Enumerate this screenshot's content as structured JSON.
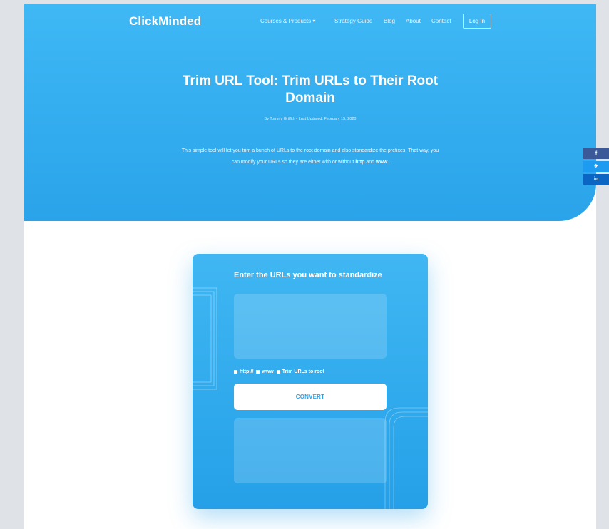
{
  "header": {
    "logo": "ClickMinded",
    "nav": [
      {
        "label": "Courses & Products ▾"
      },
      {
        "label": "Strategy Guide"
      },
      {
        "label": "Blog"
      },
      {
        "label": "About"
      },
      {
        "label": "Contact"
      }
    ],
    "login_label": "Log In"
  },
  "hero": {
    "title": "Trim URL Tool: Trim URLs to Their Root Domain",
    "byline": "By Tommy Griffith • Last Updated: February 15, 2020",
    "intro_part1": "This simple tool will let you trim a bunch of URLs to the root domain and also standardize the prefixes. That way, you can modify your URLs so they are either with or without ",
    "intro_bold1": "http",
    "intro_part2": " and ",
    "intro_bold2": "www",
    "intro_part3": "."
  },
  "tool": {
    "heading": "Enter the URLs you want to standardize",
    "input_value": "",
    "options": [
      {
        "label": "http://"
      },
      {
        "label": "www"
      },
      {
        "label": "Trim URLs to root"
      }
    ],
    "convert_label": "CONVERT",
    "output_value": ""
  },
  "share": {
    "facebook_icon": "f",
    "twitter_icon": "✈",
    "linkedin_icon": "in"
  },
  "colors": {
    "hero_top": "#3fb8f5",
    "hero_bottom": "#2aa3ea",
    "facebook": "#3b5998",
    "twitter": "#1d9bf0",
    "linkedin": "#0a66c2"
  }
}
